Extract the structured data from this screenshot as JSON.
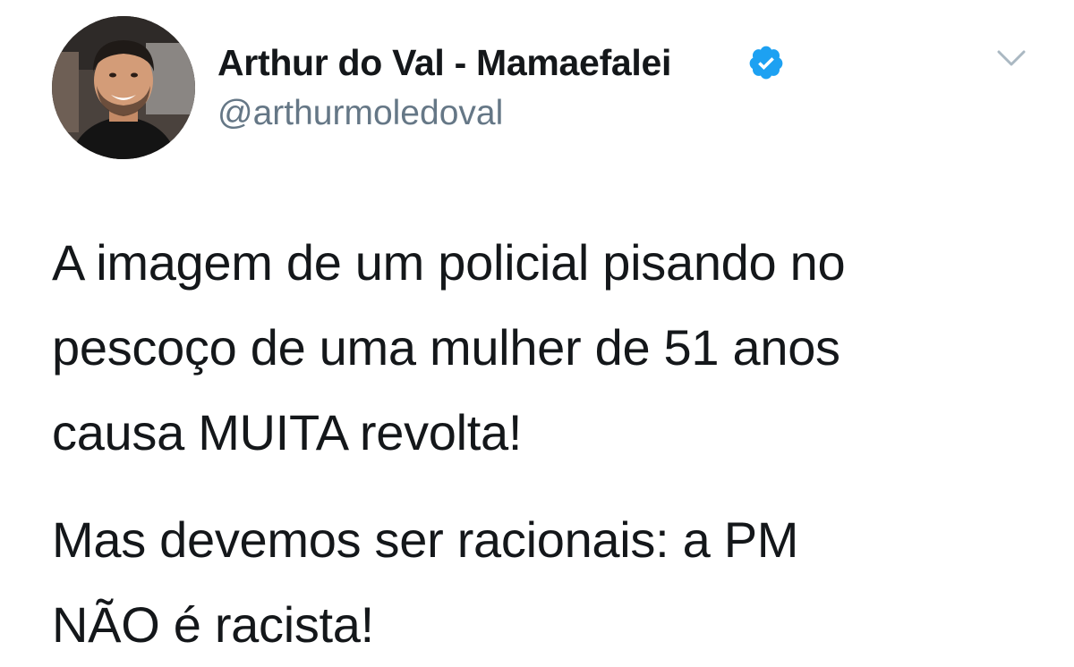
{
  "tweet": {
    "author": {
      "name": "Arthur do Val - Mamaefalei",
      "handle": "@arthurmoledoval",
      "verified": true,
      "avatar_icon": "profile-photo"
    },
    "menu_icon": "chevron-down-icon",
    "paragraphs": [
      [
        "A imagem de um policial pisando no",
        "pescoço de uma mulher de 51 anos",
        "causa MUITA revolta!"
      ],
      [
        "Mas devemos ser racionais: a PM",
        "NÃO é racista!"
      ]
    ]
  },
  "colors": {
    "text": "#14171a",
    "secondary_text": "#657786",
    "verified_badge": "#1da1f2",
    "chevron": "#aab8c2",
    "background": "#ffffff"
  }
}
